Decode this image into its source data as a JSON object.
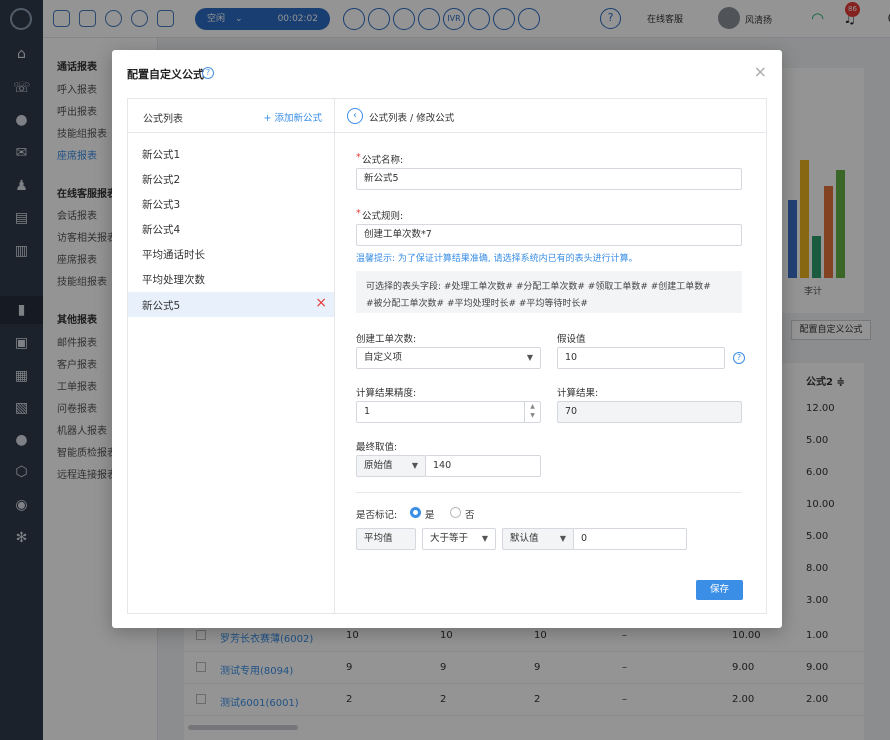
{
  "topbar": {
    "status": "空闲",
    "timer": "00:02:02",
    "call_buttons": [
      "",
      "",
      "",
      "",
      "IVR",
      "",
      "",
      ""
    ],
    "online_status": "在线客服",
    "user_name": "风清扬",
    "notification_count": "86"
  },
  "subnav": {
    "groups": [
      {
        "title": "通话报表",
        "items": [
          "呼入报表",
          "呼出报表",
          "技能组报表",
          "座席报表"
        ]
      },
      {
        "title": "在线客服报表",
        "items": [
          "会话报表",
          "访客相关报表",
          "座席报表",
          "技能组报表"
        ]
      },
      {
        "title": "其他报表",
        "items": [
          "邮件报表",
          "客户报表",
          "工单报表",
          "问卷报表",
          "机器人报表",
          "智能质检报表",
          "远程连接报表"
        ]
      }
    ]
  },
  "background": {
    "chart_xlabel": "李计",
    "config_button": "配置自定义公式",
    "column_header": "公式2 ≑",
    "column_values": [
      "12.00",
      "5.00",
      "6.00",
      "10.00",
      "5.00",
      "8.00",
      "3.00"
    ],
    "rows": [
      {
        "name": "罗芳长衣赛薄(6002)",
        "c1": "10",
        "c2": "10",
        "c3": "10",
        "c4": "–",
        "c5": "10.00",
        "c6": "1.00"
      },
      {
        "name": "测试专用(8094)",
        "c1": "9",
        "c2": "9",
        "c3": "9",
        "c4": "–",
        "c5": "9.00",
        "c6": "9.00"
      },
      {
        "name": "测试6001(6001)",
        "c1": "2",
        "c2": "2",
        "c3": "2",
        "c4": "–",
        "c5": "2.00",
        "c6": "2.00"
      }
    ]
  },
  "modal": {
    "title": "配置自定义公式",
    "list": {
      "title": "公式列表",
      "add_label": "+ 添加新公式",
      "items": [
        "新公式1",
        "新公式2",
        "新公式3",
        "新公式4",
        "平均通话时长",
        "平均处理次数",
        "新公式5"
      ]
    },
    "breadcrumb": "公式列表 / 修改公式",
    "form": {
      "name_label": "公式名称:",
      "name_value": "新公式5",
      "rule_label": "公式规则:",
      "rule_value": "创建工单次数*7",
      "hint": "温馨提示: 为了保证计算结果准确, 请选择系统内已有的表头进行计算。",
      "fields_line1": "可选择的表头字段:   #处理工单次数#   #分配工单次数#   #领取工单数#   #创建工单数#",
      "fields_line2": "#被分配工单次数#   #平均处理时长#   #平均等待时长#",
      "field_label": "创建工单次数:",
      "field_select": "自定义项",
      "assume_label": "假设值",
      "assume_value": "10",
      "precision_label": "计算结果精度:",
      "precision_value": "1",
      "result_label": "计算结果:",
      "result_value": "70",
      "final_label": "最终取值:",
      "final_select": "原始值",
      "final_value": "140",
      "mark_label": "是否标记:",
      "mark_yes": "是",
      "mark_no": "否",
      "cond_field": "平均值",
      "cond_op": "大于等于",
      "cond_type": "默认值",
      "cond_value": "0",
      "save_label": "保存"
    }
  },
  "colors": {
    "accent": "#3a8ee6",
    "danger": "#e53935",
    "sidebar": "#2f3b4c"
  }
}
